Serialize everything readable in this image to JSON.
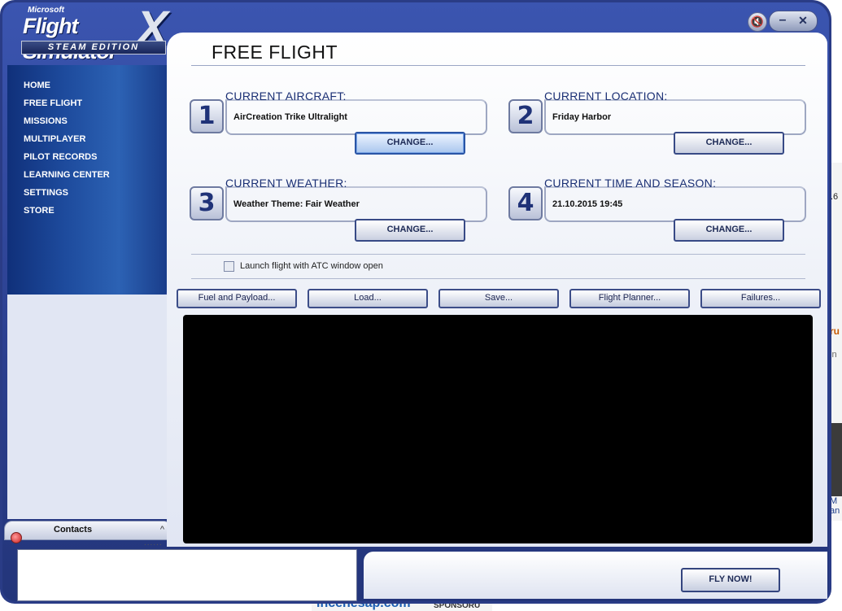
{
  "background": {
    "right_snippet": ".6",
    "right_orange": "ru",
    "right_grey": "in",
    "right_blue_1": "M",
    "right_blue_2": "an",
    "bottom_logo": "incenesap.com",
    "bottom_sponsor": "SPONSORU"
  },
  "app": {
    "logo_microsoft": "Microsoft",
    "logo_title": "Flight Simulator",
    "logo_x": "X",
    "logo_edition": "STEAM EDITION"
  },
  "window_controls": {
    "sound_icon": "speaker-mute-icon",
    "minimize_icon": "minimize-icon",
    "close_icon": "close-icon"
  },
  "sidebar": {
    "items": [
      {
        "label": "HOME"
      },
      {
        "label": "FREE FLIGHT"
      },
      {
        "label": "MISSIONS"
      },
      {
        "label": "MULTIPLAYER"
      },
      {
        "label": "PILOT RECORDS"
      },
      {
        "label": "LEARNING CENTER"
      },
      {
        "label": "SETTINGS"
      },
      {
        "label": "STORE"
      }
    ]
  },
  "contacts": {
    "label": "Contacts",
    "chevron": "^",
    "dots": "......"
  },
  "main": {
    "title": "FREE FLIGHT",
    "panels": [
      {
        "num": "1",
        "label": "CURRENT AIRCRAFT:",
        "value": "AirCreation Trike Ultralight",
        "button": "CHANGE..."
      },
      {
        "num": "2",
        "label": "CURRENT LOCATION:",
        "value": "Friday Harbor",
        "button": "CHANGE..."
      },
      {
        "num": "3",
        "label": "CURRENT WEATHER:",
        "value": "Weather Theme: Fair Weather",
        "button": "CHANGE..."
      },
      {
        "num": "4",
        "label": "CURRENT TIME AND SEASON:",
        "value": "21.10.2015 19:45",
        "button": "CHANGE..."
      }
    ],
    "atc_label": "Launch flight with ATC window open",
    "atc_checked": false,
    "tools": [
      {
        "label": "Fuel and Payload..."
      },
      {
        "label": "Load..."
      },
      {
        "label": "Save..."
      },
      {
        "label": "Flight Planner..."
      },
      {
        "label": "Failures..."
      }
    ]
  },
  "footer": {
    "fly_now": "FLY NOW!"
  },
  "colors": {
    "frame": "#2a3c86",
    "sidebar": "#1d4a9c",
    "accent_text": "#1a2f74",
    "preview": "#000000"
  }
}
